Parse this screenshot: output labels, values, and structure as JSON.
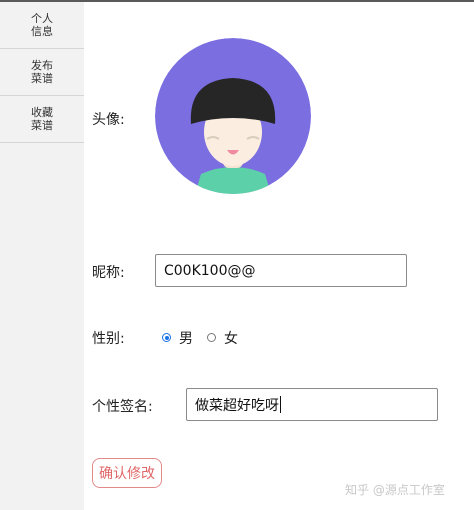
{
  "sidebar": {
    "items": [
      {
        "line1": "个人",
        "line2": "信息"
      },
      {
        "line1": "发布",
        "line2": "菜谱"
      },
      {
        "line1": "收藏",
        "line2": "菜谱"
      }
    ]
  },
  "profile": {
    "avatar_label": "头像:",
    "nickname_label": "昵称:",
    "nickname_value": "C00K100@@",
    "gender_label": "性别:",
    "gender_options": [
      "男",
      "女"
    ],
    "gender_selected": "男",
    "signature_label": "个性签名:",
    "signature_value": "做菜超好吃呀",
    "confirm_label": "确认修改"
  },
  "watermark": "知乎 @源点工作室",
  "colors": {
    "avatar_bg": "#7b6ee0",
    "hair": "#262626",
    "skin": "#fbeee0",
    "shirt": "#5cd0a8",
    "radio_accent": "#1a73e8",
    "confirm_text": "#e06767"
  }
}
